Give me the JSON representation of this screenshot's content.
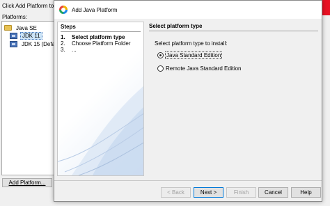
{
  "background_window": {
    "close_glyph": "✕",
    "intro_text": "Click Add Platform to re",
    "platforms_label": "Platforms:",
    "tree": [
      {
        "label": "Java SE"
      },
      {
        "label": "JDK 11"
      },
      {
        "label": "JDK 15 (Defau"
      }
    ],
    "add_platform_button": "Add Platform..."
  },
  "dialog": {
    "title": "Add Java Platform",
    "steps": {
      "heading": "Steps",
      "items": [
        {
          "num": "1.",
          "label": "Select platform type"
        },
        {
          "num": "2.",
          "label": "Choose Platform Folder"
        },
        {
          "num": "3.",
          "label": "..."
        }
      ]
    },
    "content": {
      "heading": "Select platform type",
      "prompt": "Select platform type to install:",
      "options": [
        {
          "label": "Java Standard Edition",
          "selected": true
        },
        {
          "label": "Remote Java Standard Edition",
          "selected": false
        }
      ]
    },
    "buttons": {
      "back": "< Back",
      "next": "Next >",
      "finish": "Finish",
      "cancel": "Cancel",
      "help": "Help"
    }
  },
  "colors": {
    "close_red": "#e81123",
    "selection": "#cce4f7",
    "focus_blue": "#0078d7"
  }
}
